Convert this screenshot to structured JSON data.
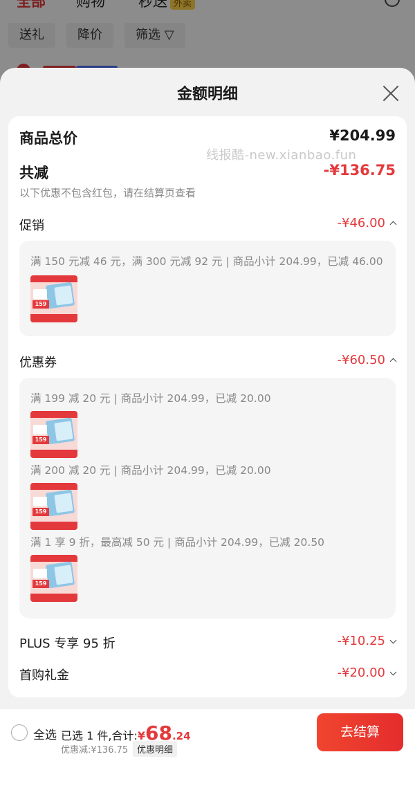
{
  "background": {
    "tabs": [
      "全部",
      "购物",
      "秒送"
    ],
    "tab_badge": "外卖",
    "filters": [
      "送礼",
      "降价",
      "筛选"
    ]
  },
  "sheet": {
    "title": "金额明细",
    "total_label": "商品总价",
    "total_value": "¥204.99",
    "watermark": "线报酷-new.xianbao.fun",
    "reduce_label": "共减",
    "reduce_value": "-¥136.75",
    "note": "以下优惠不包含红包，请在结算页查看",
    "promo": {
      "label": "促销",
      "value": "-¥46.00",
      "lines": [
        "满 150 元减 46 元，满 300 元减 92 元 | 商品小计 204.99，已减 46.00"
      ]
    },
    "coupon": {
      "label": "优惠券",
      "value": "-¥60.50",
      "lines": [
        "满 199 减 20 元 | 商品小计 204.99，已减 20.00",
        "满 200 减 20 元 | 商品小计 204.99，已减 20.00",
        "满 1 享 9 折，最高减 50 元 | 商品小计 204.99，已减 20.50"
      ]
    },
    "plus": {
      "label": "PLUS 专享 95 折",
      "value": "-¥10.25"
    },
    "first": {
      "label": "首购礼金",
      "value": "-¥20.00"
    },
    "thumb_price": "159"
  },
  "bottom": {
    "select_all": "全选",
    "selected": "已选 1 件,合计:",
    "currency": "¥",
    "total_int": "68",
    "total_dec": ".24",
    "discount": "优惠减:¥136.75",
    "detail_link": "优惠明细",
    "checkout": "去结算"
  },
  "colors": {
    "accent": "#e4393c",
    "sheet_bg": "#f2f2f2",
    "card_bg": "#ffffff"
  }
}
